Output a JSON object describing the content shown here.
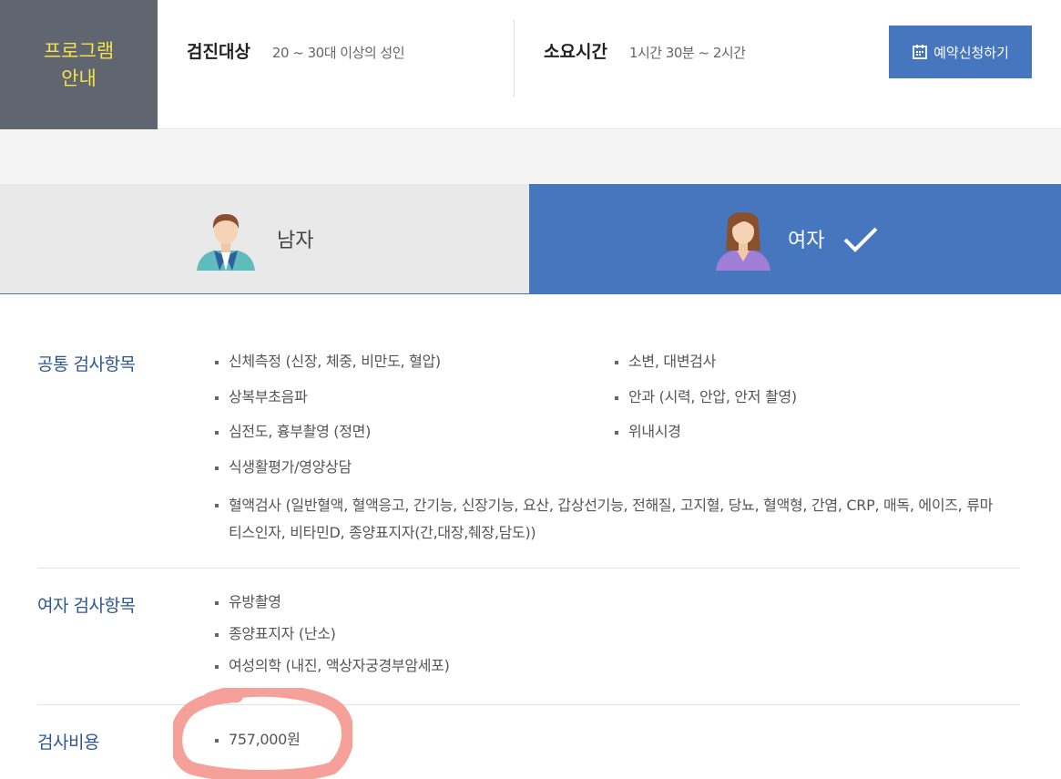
{
  "header": {
    "program_label": "프로그램 안내",
    "target_title": "검진대상",
    "target_value": "20 ~ 30대 이상의 성인",
    "duration_title": "소요시간",
    "duration_value": "1시간 30분 ~ 2시간",
    "reserve_button": "예약신청하기",
    "reserve_icon": "calendar-icon",
    "program_label_color": "#f5e14b",
    "program_box_color": "#5f6670",
    "accent_color": "#4677be"
  },
  "tabs": {
    "male": {
      "label": "남자",
      "icon": "male-avatar-icon",
      "selected": false
    },
    "female": {
      "label": "여자",
      "icon": "female-avatar-icon",
      "selected": true
    }
  },
  "common_section": {
    "title": "공통 검사항목",
    "left_items": [
      "신체측정 (신장, 체중, 비만도, 혈압)",
      "상복부초음파",
      "심전도, 흉부촬영 (정면)",
      "식생활평가/영양상담"
    ],
    "right_items": [
      "소변, 대변검사",
      "안과 (시력, 안압, 안저 촬영)",
      "위내시경"
    ],
    "wide_item": "혈액검사 (일반혈액, 혈액응고, 간기능, 신장기능, 요산, 갑상선기능, 전해질, 고지혈, 당뇨, 혈액형, 간염, CRP, 매독, 에이즈, 류마티스인자, 비타민D, 종양표지자(간,대장,췌장,담도))"
  },
  "female_section": {
    "title": "여자 검사항목",
    "items": [
      "유방촬영",
      "종양표지자 (난소)",
      "여성의학 (내진, 액상자궁경부암세포)"
    ]
  },
  "cost_section": {
    "title": "검사비용",
    "value": "757,000원",
    "highlight_color": "#f28b82"
  }
}
